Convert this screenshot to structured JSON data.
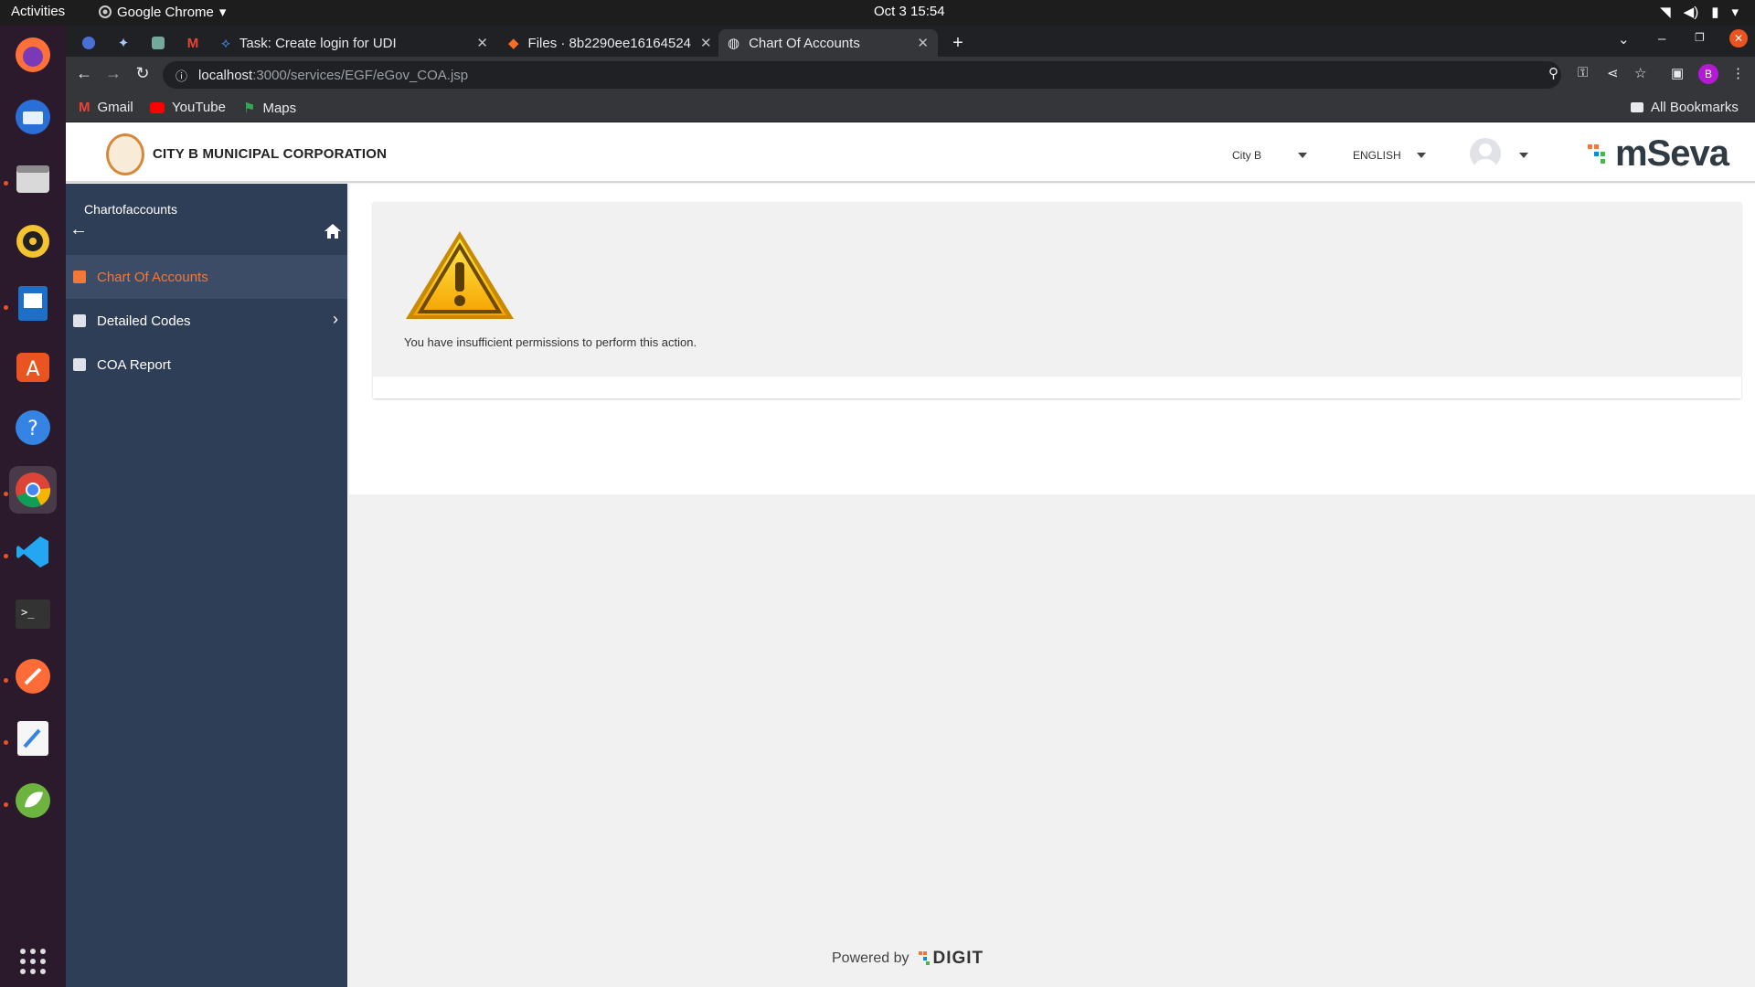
{
  "os": {
    "activities": "Activities",
    "app_name": "Google Chrome",
    "clock": "Oct 3  15:54"
  },
  "browser": {
    "tabs": [
      {
        "label": "Task: Create login for UDI"
      },
      {
        "label": "Files · 8b2290ee16164524"
      },
      {
        "label": "Chart Of Accounts"
      }
    ],
    "url_host": "localhost",
    "url_path": ":3000/services/EGF/eGov_COA.jsp",
    "profile_initial": "B",
    "bookmarks": [
      {
        "label": "Gmail"
      },
      {
        "label": "YouTube"
      },
      {
        "label": "Maps"
      }
    ],
    "all_bookmarks": "All Bookmarks"
  },
  "header": {
    "corporation": "CITY B MUNICIPAL CORPORATION",
    "city": "City B",
    "language": "ENGLISH",
    "brand": "mSeva"
  },
  "sidebar": {
    "title": "Chartofaccounts",
    "items": [
      {
        "label": "Chart Of Accounts"
      },
      {
        "label": "Detailed Codes"
      },
      {
        "label": "COA Report"
      }
    ]
  },
  "main": {
    "message": "You have insufficient permissions to perform this action."
  },
  "footer": {
    "powered_by": "Powered by",
    "digit": "DIGIT"
  }
}
